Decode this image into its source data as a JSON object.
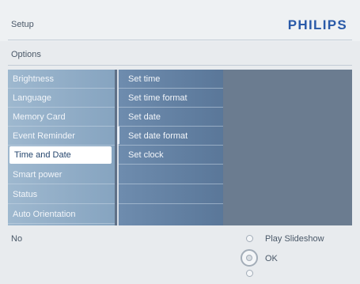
{
  "header": {
    "title": "Setup",
    "brand": "PHILIPS"
  },
  "options_label": "Options",
  "menu": {
    "items": [
      "Brightness",
      "Language",
      "Memory Card",
      "Event Reminder",
      "Time and Date",
      "Smart power",
      "Status",
      "Auto Orientation"
    ],
    "selected": "Time and Date"
  },
  "submenu": {
    "items": [
      "Set time",
      "Set time format",
      "Set date",
      "Set date format",
      "Set clock"
    ]
  },
  "footer": {
    "left": "No",
    "play_slideshow": "Play Slideshow",
    "ok": "OK"
  },
  "colors": {
    "brand": "#2a5aa8",
    "menu_bg": "#86a4c0",
    "selected_bg": "#ffffff"
  },
  "icons": [
    "radio-icon",
    "ok-dial-icon"
  ]
}
